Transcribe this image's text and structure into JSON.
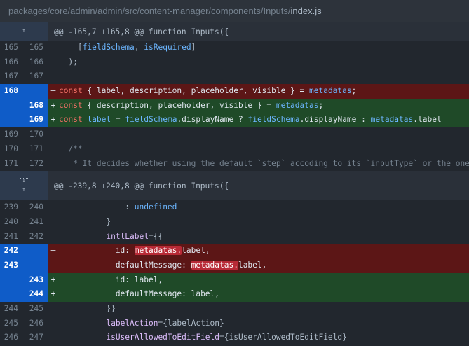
{
  "file": {
    "path_prefix": "packages/core/admin/admin/src/content-manager/components/Inputs/",
    "file_name": "index.js"
  },
  "hunks": [
    {
      "header": "@@ -165,7 +165,8 @@ function Inputs({",
      "lines": [
        {
          "type": "ctx",
          "old": "165",
          "new": "165",
          "sign": "",
          "code": "    [fieldSchema, isRequired]"
        },
        {
          "type": "ctx",
          "old": "166",
          "new": "166",
          "sign": "",
          "code": "  );"
        },
        {
          "type": "ctx",
          "old": "167",
          "new": "167",
          "sign": "",
          "code": ""
        },
        {
          "type": "del",
          "old": "168",
          "new": "",
          "sign": "–",
          "code": "const { label, description, placeholder, visible } = metadatas;"
        },
        {
          "type": "add",
          "old": "",
          "new": "168",
          "sign": "+",
          "code": "const { description, placeholder, visible } = metadatas;"
        },
        {
          "type": "add",
          "old": "",
          "new": "169",
          "sign": "+",
          "code": "const label = fieldSchema.displayName ? fieldSchema.displayName : metadatas.label"
        },
        {
          "type": "ctx",
          "old": "169",
          "new": "170",
          "sign": "",
          "code": ""
        },
        {
          "type": "ctx",
          "old": "170",
          "new": "171",
          "sign": "",
          "code": "  /**"
        },
        {
          "type": "ctx",
          "old": "171",
          "new": "172",
          "sign": "",
          "code": "   * It decides whether using the default `step` accoding to its `inputType` or the one"
        }
      ]
    },
    {
      "header": "@@ -239,8 +240,8 @@ function Inputs({",
      "lines": [
        {
          "type": "ctx",
          "old": "239",
          "new": "240",
          "sign": "",
          "code": "              : undefined"
        },
        {
          "type": "ctx",
          "old": "240",
          "new": "241",
          "sign": "",
          "code": "          }"
        },
        {
          "type": "ctx",
          "old": "241",
          "new": "242",
          "sign": "",
          "code": "          intlLabel={{"
        },
        {
          "type": "del",
          "old": "242",
          "new": "",
          "sign": "–",
          "code": "  id: metadatas.label,"
        },
        {
          "type": "del",
          "old": "243",
          "new": "",
          "sign": "–",
          "code": "  defaultMessage: metadatas.label,"
        },
        {
          "type": "add",
          "old": "",
          "new": "243",
          "sign": "+",
          "code": "  id: label,"
        },
        {
          "type": "add",
          "old": "",
          "new": "244",
          "sign": "+",
          "code": "  defaultMessage: label,"
        },
        {
          "type": "ctx",
          "old": "244",
          "new": "245",
          "sign": "",
          "code": "          }}"
        },
        {
          "type": "ctx",
          "old": "245",
          "new": "246",
          "sign": "",
          "code": "          labelAction={labelAction}"
        },
        {
          "type": "ctx",
          "old": "246",
          "new": "247",
          "sign": "",
          "code": "          isUserAllowedToEditField={isUserAllowedToEditField}"
        }
      ]
    }
  ],
  "icons": {
    "expand_up": "expand-up-icon",
    "expand_down": "expand-down-icon"
  },
  "colors": {
    "background": "#22272e",
    "deletion_bg": "#5c1616",
    "addition_bg": "#1f4a28",
    "line_number_highlight": "#0f5cc8",
    "word_highlight": "#b82a36"
  }
}
